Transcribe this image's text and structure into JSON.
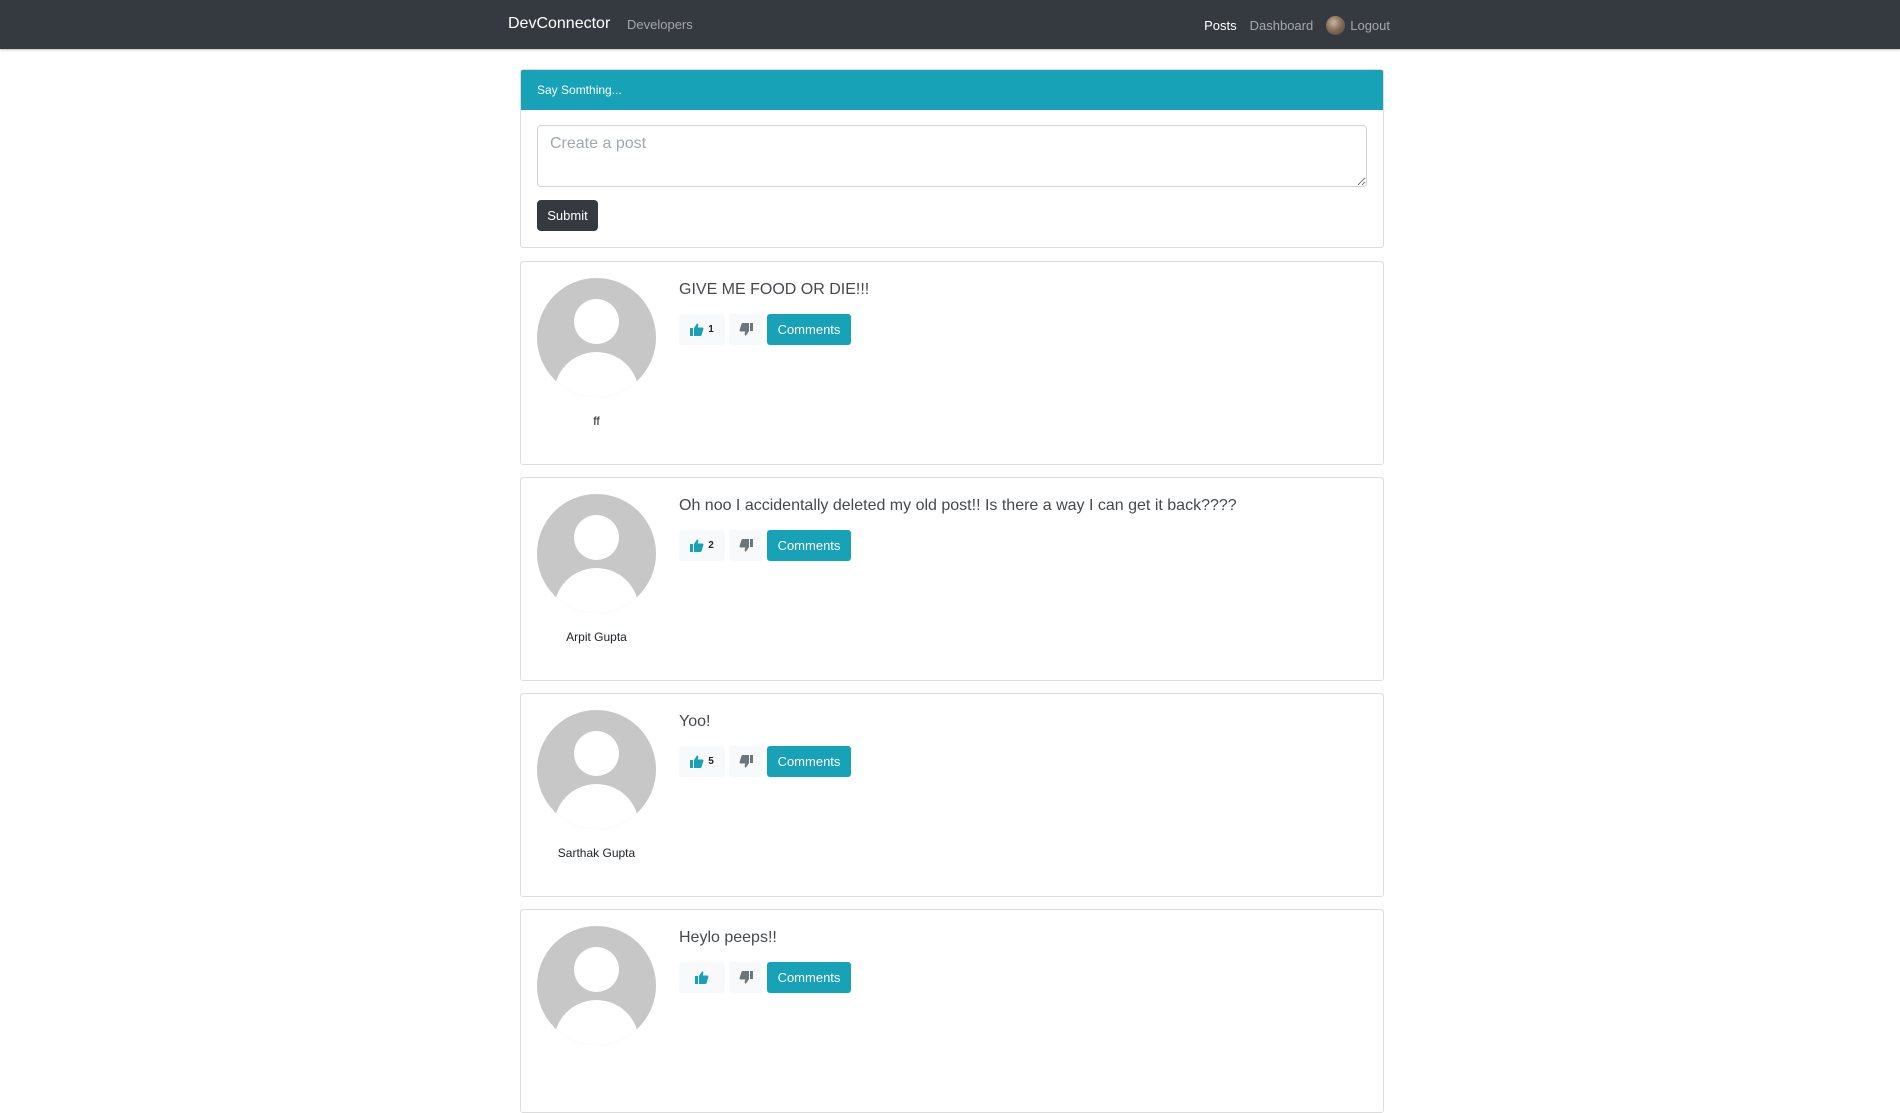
{
  "navbar": {
    "brand": "DevConnector",
    "developers_label": "Developers",
    "posts_label": "Posts",
    "dashboard_label": "Dashboard",
    "logout_label": "Logout"
  },
  "post_form": {
    "header": "Say Somthing...",
    "placeholder": "Create a post",
    "submit_label": "Submit"
  },
  "posts": [
    {
      "text": "GIVE ME FOOD OR DIE!!!",
      "author": "ff",
      "likes": "1",
      "comments_label": "Comments"
    },
    {
      "text": "Oh noo I accidentally deleted my old post!! Is there a way I can get it back????",
      "author": "Arpit Gupta",
      "likes": "2",
      "comments_label": "Comments"
    },
    {
      "text": "Yoo!",
      "author": "Sarthak Gupta",
      "likes": "5",
      "comments_label": "Comments"
    },
    {
      "text": "Heylo peeps!!",
      "comments_label": "Comments"
    }
  ],
  "colors": {
    "navbar": "#343a40",
    "accent": "#17a2b8",
    "avatar_placeholder": "#c7c7c7"
  },
  "icons": {
    "like": "thumbs-up-icon",
    "dislike": "thumbs-down-icon"
  }
}
